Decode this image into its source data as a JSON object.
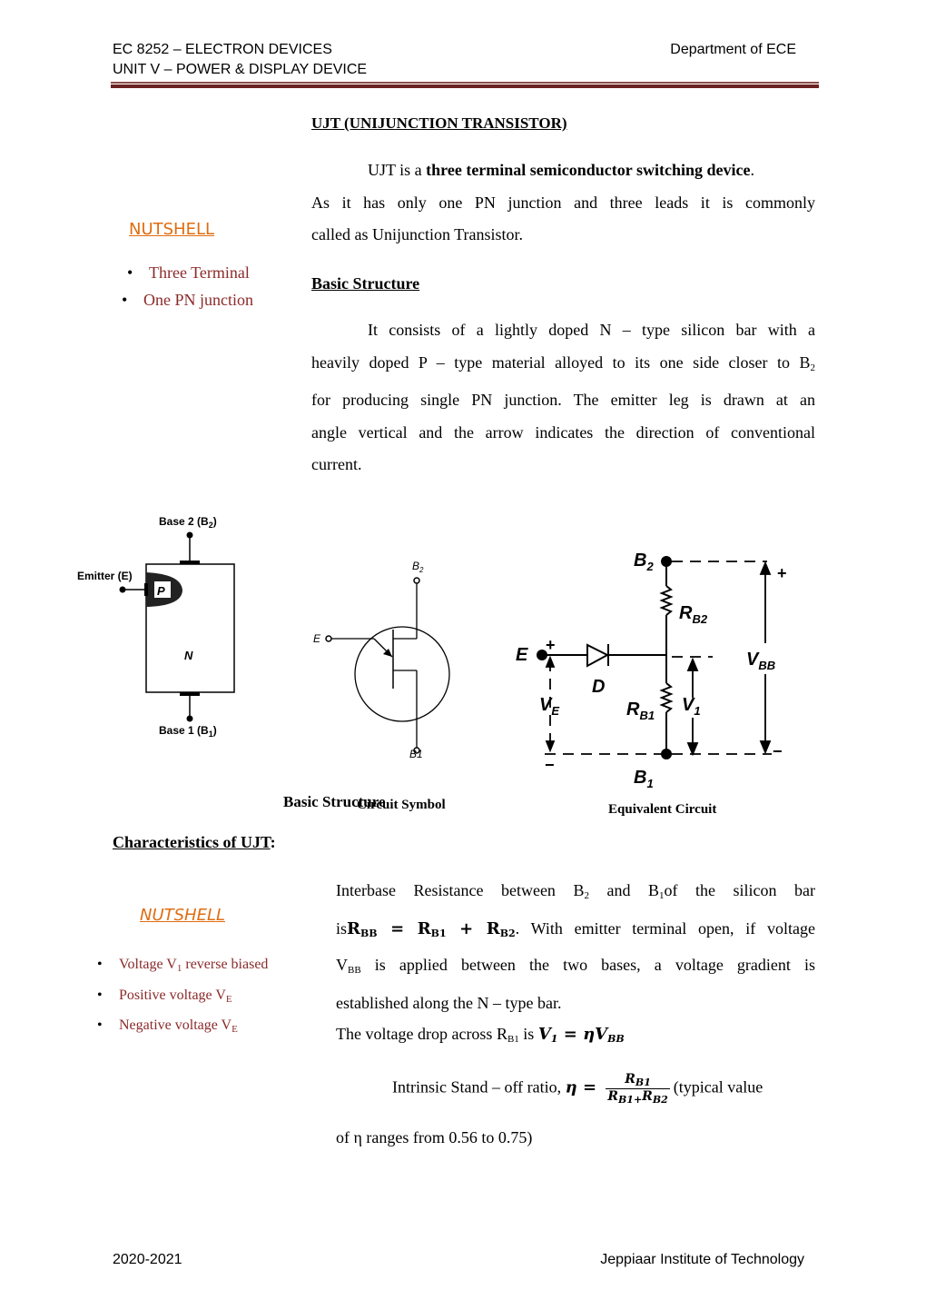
{
  "header": {
    "course": "EC 8252 – ELECTRON DEVICES",
    "unit": "UNIT V – POWER & DISPLAY DEVICE",
    "department": "Department of ECE"
  },
  "section_title": "UJT (UNIJUNCTION TRANSISTOR)",
  "intro": {
    "prefix": "UJT is a ",
    "bold": "three terminal semiconductor switching device",
    "suffix": ".",
    "line2": "As it has only one PN junction and three leads it is commonly",
    "line3": "called as Unijunction Transistor."
  },
  "nutshell1": {
    "title": "NUTSHELL",
    "items": [
      "Three Terminal",
      "One PN junction"
    ]
  },
  "basic_structure": {
    "heading": "Basic Structure",
    "paragraph_lines": [
      "It consists of a lightly doped N – type silicon bar with a",
      "heavily doped P – type material alloyed to its one side closer to B",
      "for producing single PN junction. The emitter leg is drawn at an",
      "angle vertical and the arrow indicates the direction of conventional",
      "current."
    ],
    "subscript_2": "2"
  },
  "figures": {
    "structure": {
      "base2": "Base 2 (B",
      "base2_sub": "2",
      "base1": "Base 1 (B",
      "base1_sub": "1",
      "emitter": "Emitter (E)",
      "p": "P",
      "n": "N",
      "close": ")"
    },
    "symbol": {
      "b2": "B",
      "b2_sub": "2",
      "b1": "B1",
      "e": "E"
    },
    "equivalent": {
      "b2": "B",
      "b2_sub": "2",
      "b1": "B",
      "b1_sub": "1",
      "e": "E",
      "d": "D",
      "rb2": "R",
      "rb2_sub": "B2",
      "rb1": "R",
      "rb1_sub": "B1",
      "v1": "V",
      "v1_sub": "1",
      "ve": "V",
      "ve_sub": "E",
      "vbb": "V",
      "vbb_sub": "BB",
      "plus": "+",
      "minus": "−"
    },
    "captions": {
      "structure": "Basic Structure",
      "symbol": "Circuit Symbol",
      "equivalent": "Equivalent Circuit"
    }
  },
  "characteristics": {
    "heading": "Characteristics of UJT",
    "colon": ":"
  },
  "nutshell2": {
    "title": "NUTSHELL",
    "items": [
      {
        "text": "Voltage V",
        "sub": "1",
        "rest": " reverse biased"
      },
      {
        "text": "Positive voltage V",
        "sub": "E",
        "rest": ""
      },
      {
        "text": "Negative voltage V",
        "sub": "E",
        "rest": ""
      }
    ]
  },
  "interbase": {
    "l1a": "Interbase Resistance between B",
    "l1s1": "2",
    "l1b": " and B",
    "l1s2": "1",
    "l1c": "of the silicon bar",
    "l2a": "is",
    "eq_rbb": "R",
    "eq_rbb_sub": "BB",
    "eq_eq": " = ",
    "eq_rb1": "R",
    "eq_rb1_sub": "B1",
    "eq_plus": " + ",
    "eq_rb2": "R",
    "eq_rb2_sub": "B2",
    "l2b": ". With emitter terminal open, if voltage",
    "l3a": "V",
    "l3s": "BB",
    "l3b": " is applied between the two bases, a voltage gradient is",
    "l4": "established along the N – type bar."
  },
  "voltage_drop": {
    "text": "The voltage drop across R",
    "sub": "B1",
    "mid": " is ",
    "v": "V",
    "v_sub": "1",
    "eq": " = ",
    "eta": "η",
    "vbb": "V",
    "vbb_sub": "BB"
  },
  "standoff": {
    "text": "Intrinsic Stand – off ratio, ",
    "eta": "η",
    "eq": " = ",
    "num": "R",
    "num_sub": "B1",
    "den_a": "R",
    "den_a_sub": "B1+",
    "den_b": "R",
    "den_b_sub": "B2",
    "after": "(typical value",
    "line2": "of η ranges from 0.56 to 0.75)"
  },
  "footer": {
    "year": "2020-2021",
    "institute": "Jeppiaar Institute of Technology"
  }
}
